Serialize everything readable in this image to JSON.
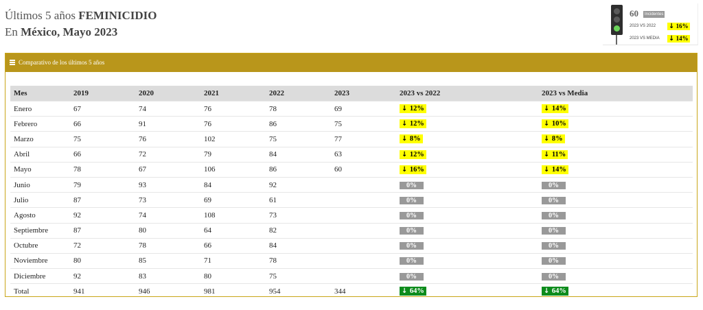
{
  "header": {
    "line1_prefix": "Últimos 5 años",
    "line1_bold": "FEMINICIDIO",
    "line2_prefix": "En",
    "line2_bold": "México, Mayo 2023"
  },
  "summary": {
    "count": "60",
    "count_label": "Incidentes",
    "rows": [
      {
        "label": "2023 VS 2022",
        "value": "16%"
      },
      {
        "label": "2023 VS MEDIA",
        "value": "14%"
      }
    ],
    "traffic_light_active": "green"
  },
  "panel": {
    "title": "Comparativo de los últimos 5 años"
  },
  "table": {
    "headers": [
      "Mes",
      "2019",
      "2020",
      "2021",
      "2022",
      "2023",
      "2023 vs 2022",
      "2023 vs Media"
    ],
    "rows": [
      {
        "mes": "Enero",
        "y2019": "67",
        "y2020": "74",
        "y2021": "76",
        "y2022": "78",
        "y2023": "69",
        "vs2022": "12%",
        "vsMedia": "14%",
        "kind": "down"
      },
      {
        "mes": "Febrero",
        "y2019": "66",
        "y2020": "91",
        "y2021": "76",
        "y2022": "86",
        "y2023": "75",
        "vs2022": "12%",
        "vsMedia": "10%",
        "kind": "down"
      },
      {
        "mes": "Marzo",
        "y2019": "75",
        "y2020": "76",
        "y2021": "102",
        "y2022": "75",
        "y2023": "77",
        "vs2022": " 8%",
        "vsMedia": " 8%",
        "kind": "down"
      },
      {
        "mes": "Abril",
        "y2019": "66",
        "y2020": "72",
        "y2021": "79",
        "y2022": "84",
        "y2023": "63",
        "vs2022": "12%",
        "vsMedia": "11%",
        "kind": "down"
      },
      {
        "mes": "Mayo",
        "y2019": "78",
        "y2020": "67",
        "y2021": "106",
        "y2022": "86",
        "y2023": "60",
        "vs2022": "16%",
        "vsMedia": "14%",
        "kind": "down"
      },
      {
        "mes": "Junio",
        "y2019": "79",
        "y2020": "93",
        "y2021": "84",
        "y2022": "92",
        "y2023": "",
        "vs2022": "0%",
        "vsMedia": "0%",
        "kind": "zero"
      },
      {
        "mes": "Julio",
        "y2019": "87",
        "y2020": "73",
        "y2021": "69",
        "y2022": "61",
        "y2023": "",
        "vs2022": "0%",
        "vsMedia": "0%",
        "kind": "zero"
      },
      {
        "mes": "Agosto",
        "y2019": "92",
        "y2020": "74",
        "y2021": "108",
        "y2022": "73",
        "y2023": "",
        "vs2022": "0%",
        "vsMedia": "0%",
        "kind": "zero"
      },
      {
        "mes": "Septiembre",
        "y2019": "87",
        "y2020": "80",
        "y2021": "64",
        "y2022": "82",
        "y2023": "",
        "vs2022": "0%",
        "vsMedia": "0%",
        "kind": "zero"
      },
      {
        "mes": "Octubre",
        "y2019": "72",
        "y2020": "78",
        "y2021": "66",
        "y2022": "84",
        "y2023": "",
        "vs2022": "0%",
        "vsMedia": "0%",
        "kind": "zero"
      },
      {
        "mes": "Noviembre",
        "y2019": "80",
        "y2020": "85",
        "y2021": "71",
        "y2022": "78",
        "y2023": "",
        "vs2022": "0%",
        "vsMedia": "0%",
        "kind": "zero"
      },
      {
        "mes": "Diciembre",
        "y2019": "92",
        "y2020": "83",
        "y2021": "80",
        "y2022": "75",
        "y2023": "",
        "vs2022": "0%",
        "vsMedia": "0%",
        "kind": "zero"
      },
      {
        "mes": "Total",
        "y2019": "941",
        "y2020": "946",
        "y2021": "981",
        "y2022": "954",
        "y2023": "344",
        "vs2022": "64%",
        "vsMedia": "64%",
        "kind": "total"
      }
    ]
  },
  "colors": {
    "panel_header": "#b9961b",
    "badge_down": "#ffff00",
    "badge_zero": "#999999",
    "badge_total": "#0d8c1c"
  },
  "icons": {
    "menu": "hamburger-icon",
    "arrow": "arrow-down-icon",
    "traffic_light": "traffic-light-icon"
  }
}
